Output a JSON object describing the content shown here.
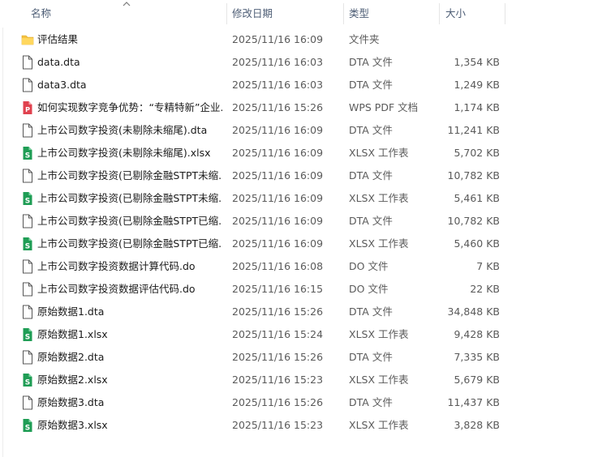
{
  "columns": {
    "name": "名称",
    "modified": "修改日期",
    "type": "类型",
    "size": "大小"
  },
  "colors": {
    "folder": "#f5c242",
    "xlsx": "#1f9d55",
    "pdf": "#e0424f",
    "header_text": "#4d5d75"
  },
  "files": [
    {
      "name": "评估结果",
      "date": "2025/11/16 16:09",
      "type": "文件夹",
      "size": "",
      "icon": "folder-icon"
    },
    {
      "name": "data.dta",
      "date": "2025/11/16 16:03",
      "type": "DTA 文件",
      "size": "1,354 KB",
      "icon": "file-icon"
    },
    {
      "name": "data3.dta",
      "date": "2025/11/16 16:03",
      "type": "DTA 文件",
      "size": "1,249 KB",
      "icon": "file-icon"
    },
    {
      "name": "如何实现数字竞争优势：“专精特新”企业...",
      "date": "2025/11/16 15:26",
      "type": "WPS PDF 文档",
      "size": "1,174 KB",
      "icon": "pdf-icon"
    },
    {
      "name": "上市公司数字投资(未剔除未缩尾).dta",
      "date": "2025/11/16 16:09",
      "type": "DTA 文件",
      "size": "11,241 KB",
      "icon": "file-icon"
    },
    {
      "name": "上市公司数字投资(未剔除未缩尾).xlsx",
      "date": "2025/11/16 16:09",
      "type": "XLSX 工作表",
      "size": "5,702 KB",
      "icon": "xlsx-icon"
    },
    {
      "name": "上市公司数字投资(已剔除金融STPT未缩...",
      "date": "2025/11/16 16:09",
      "type": "DTA 文件",
      "size": "10,782 KB",
      "icon": "file-icon"
    },
    {
      "name": "上市公司数字投资(已剔除金融STPT未缩...",
      "date": "2025/11/16 16:09",
      "type": "XLSX 工作表",
      "size": "5,461 KB",
      "icon": "xlsx-icon"
    },
    {
      "name": "上市公司数字投资(已剔除金融STPT已缩...",
      "date": "2025/11/16 16:09",
      "type": "DTA 文件",
      "size": "10,782 KB",
      "icon": "file-icon"
    },
    {
      "name": "上市公司数字投资(已剔除金融STPT已缩...",
      "date": "2025/11/16 16:09",
      "type": "XLSX 工作表",
      "size": "5,460 KB",
      "icon": "xlsx-icon"
    },
    {
      "name": "上市公司数字投资数据计算代码.do",
      "date": "2025/11/16 16:08",
      "type": "DO 文件",
      "size": "7 KB",
      "icon": "file-icon"
    },
    {
      "name": "上市公司数字投资数据评估代码.do",
      "date": "2025/11/16 16:15",
      "type": "DO 文件",
      "size": "22 KB",
      "icon": "file-icon"
    },
    {
      "name": "原始数据1.dta",
      "date": "2025/11/16 15:26",
      "type": "DTA 文件",
      "size": "34,848 KB",
      "icon": "file-icon"
    },
    {
      "name": "原始数据1.xlsx",
      "date": "2025/11/16 15:24",
      "type": "XLSX 工作表",
      "size": "9,428 KB",
      "icon": "xlsx-icon"
    },
    {
      "name": "原始数据2.dta",
      "date": "2025/11/16 15:26",
      "type": "DTA 文件",
      "size": "7,335 KB",
      "icon": "file-icon"
    },
    {
      "name": "原始数据2.xlsx",
      "date": "2025/11/16 15:23",
      "type": "XLSX 工作表",
      "size": "5,679 KB",
      "icon": "xlsx-icon"
    },
    {
      "name": "原始数据3.dta",
      "date": "2025/11/16 15:26",
      "type": "DTA 文件",
      "size": "11,437 KB",
      "icon": "file-icon"
    },
    {
      "name": "原始数据3.xlsx",
      "date": "2025/11/16 15:23",
      "type": "XLSX 工作表",
      "size": "3,828 KB",
      "icon": "xlsx-icon"
    }
  ]
}
